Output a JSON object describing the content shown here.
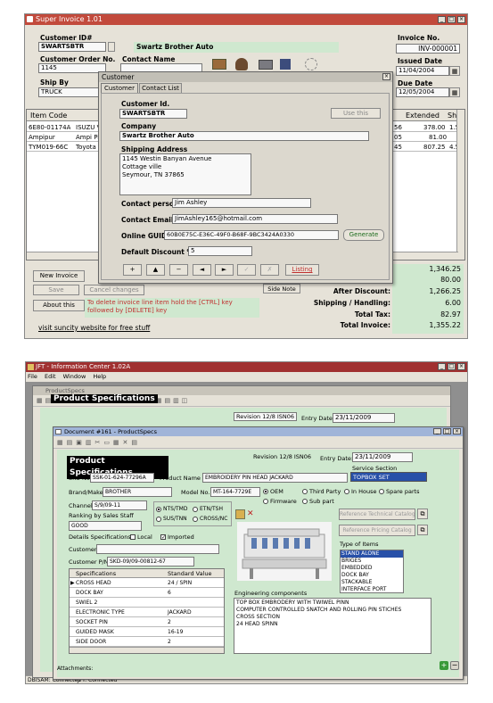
{
  "win1": {
    "title": "Super Invoice 1.01",
    "customer_id_label": "Customer ID#",
    "customer_id": "SWARTSBTR",
    "customer_name": "Swartz Brother Auto",
    "order_no_label": "Customer Order No.",
    "order_no": "1145",
    "contact_name_label": "Contact Name",
    "ship_by_label": "Ship By",
    "ship_by": "TRUCK",
    "invoice_no_label": "Invoice No.",
    "invoice_no": "INV-000001",
    "issued_label": "Issued Date",
    "issued": "11/04/2004",
    "due_label": "Due Date",
    "due": "12/05/2004",
    "grid_headers": [
      "Item Code",
      "Extended",
      "Sh"
    ],
    "rows": [
      {
        "code": "6E80-01174A",
        "desc": "ISUZU V",
        "q": "56",
        "ext": "378.00",
        "sh": "1.5"
      },
      {
        "code": "Ampipur",
        "desc": "Ampi Pi",
        "q": "05",
        "ext": "81.00",
        "sh": ""
      },
      {
        "code": "TYM019-66C",
        "desc": "Toyota",
        "q": "45",
        "ext": "807.25",
        "sh": "4.5"
      }
    ],
    "new_invoice": "New Invoice",
    "save": "Save",
    "cancel_changes": "Cancel changes",
    "about": "About this",
    "side_note": "Side Note",
    "tip": "To delete invoice line item hold the [CTRL] key followed by [DELETE] key",
    "link": "visit suncity website for free stuff",
    "totals": [
      {
        "label": "",
        "value": "1,346.25"
      },
      {
        "label": ":",
        "value": "80.00"
      },
      {
        "label": "After Discount:",
        "value": "1,266.25"
      },
      {
        "label": "Shipping / Handling:",
        "value": "6.00"
      },
      {
        "label": "Total Tax:",
        "value": "82.97"
      },
      {
        "label": "Total Invoice:",
        "value": "1,355.22"
      }
    ]
  },
  "dialog": {
    "title": "Customer",
    "tabs": [
      "Customer",
      "Contact List"
    ],
    "cust_id_label": "Customer Id.",
    "cust_id": "SWARTSBTR",
    "company_label": "Company",
    "company": "Swartz Brother Auto",
    "shipping_label": "Shipping Address",
    "address1": "1145 Westin Banyan Avenue",
    "address2": "Cottage ville",
    "address3": "Seymour, TN 37865",
    "use_this": "Use this",
    "contact_person_label": "Contact person",
    "contact_person": "Jim Ashley",
    "contact_email_label": "Contact Email",
    "contact_email": "JimAshley165@hotmail.com",
    "guid_label": "Online GUID",
    "guid": "60B0E75C-E36C-49F0-B68F-9BC3424A0330",
    "generate": "Generate",
    "discount_label": "Default Discount %",
    "discount": "5",
    "nav": [
      "+",
      "▲",
      "−",
      "◄",
      "►",
      "✓",
      "✗"
    ],
    "listing": "Listing"
  },
  "win2": {
    "title": "JFT - Information Center 1.02A",
    "menu": [
      "File",
      "Edit",
      "Window",
      "Help"
    ],
    "bg_doc_title": "ProductSpecs",
    "bg_heading": "Product Specifications",
    "bg_revision": "Revision 12/8 ISN06",
    "bg_entry_label": "Entry Date:",
    "bg_entry": "23/11/2009",
    "status1": "DBISAM: Connected",
    "status2": "JFT: Connected"
  },
  "doc": {
    "title": "Document #161 - ProductSpecs",
    "heading": "Product Specifications",
    "revision": "Revision 12/8 ISN06",
    "entry_label": "Entry Date:",
    "entry": "23/11/2009",
    "service_label": "Service Section",
    "service": "TOPBOX SET",
    "sku_label": "SKU No",
    "sku": "SSK-01-624-77296A",
    "pname_label": "Product Name",
    "pname": "EMBROIDERY PIN HEAD JACKARD",
    "brand_label": "Brand/Maker",
    "brand": "BROTHER",
    "model_label": "Model No.",
    "model": "MT-164-7729E",
    "radios1": [
      "OEM",
      "Third Party",
      "In House",
      "Spare parts"
    ],
    "radios2": [
      "Firmware",
      "Sub part"
    ],
    "channel_label": "Channel",
    "channel": "S/9/09-11",
    "rank_label": "Ranking by Sales Staff",
    "rank": "GOOD",
    "radios3": [
      "NTS/TMD",
      "ETN/TSH",
      "SUS/TNN",
      "CROSS/NC"
    ],
    "details_label": "Details Specifications",
    "local": "Local",
    "imported": "Imported",
    "customer_label": "Customer",
    "cpn_label": "Customer P/N",
    "cpn": "SKD-09/09-00812-67",
    "ref_tech": "Reference Technical Catalog",
    "ref_price": "Reference Pricing Catalog",
    "type_label": "Type of Items",
    "types": [
      "STAND ALONE",
      "BRIGES",
      "EMBEDDED",
      "DOCK BAY",
      "STACKABLE",
      "INTERFACE PORT"
    ],
    "spec_headers": [
      "Specifications",
      "Standard Value"
    ],
    "specs": [
      [
        "CROSS HEAD",
        "24 / SPIN"
      ],
      [
        "DOCK BAY",
        "6"
      ],
      [
        "SWIEL 2",
        ""
      ],
      [
        "ELECTRONIC TYPE",
        "JACKARD"
      ],
      [
        "SOCKET PIN",
        "2"
      ],
      [
        "GUIDED MASK",
        "16-19"
      ],
      [
        "SIDE DOOR",
        "2"
      ]
    ],
    "eng_label": "Engineering components",
    "eng_lines": [
      "TOP BOX EMBRODERY WITH TWIWEL PINN",
      "COMPUTER CONTROLLED SNATCH AND ROLLING PIN STICHES",
      "CROSS SECTION",
      "24 HEAD SPINN"
    ],
    "attachments": "Attachments:"
  }
}
